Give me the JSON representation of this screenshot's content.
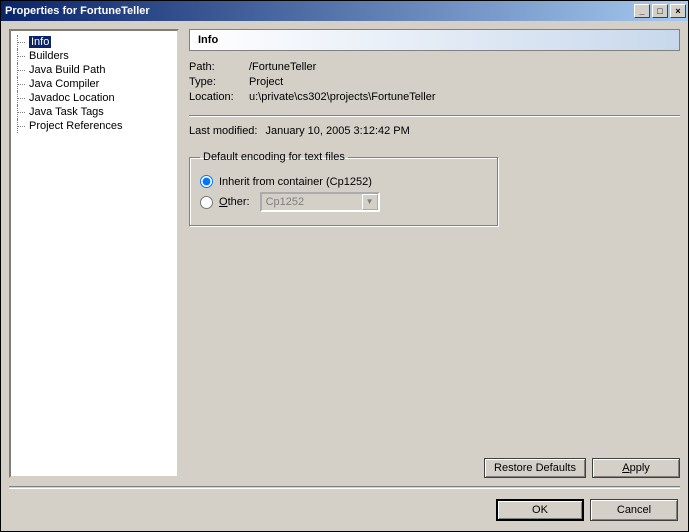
{
  "window": {
    "title": "Properties for FortuneTeller"
  },
  "sidebar": {
    "items": [
      {
        "label": "Info",
        "selected": true
      },
      {
        "label": "Builders"
      },
      {
        "label": "Java Build Path"
      },
      {
        "label": "Java Compiler"
      },
      {
        "label": "Javadoc Location"
      },
      {
        "label": "Java Task Tags"
      },
      {
        "label": "Project References"
      }
    ]
  },
  "panel": {
    "header": "Info",
    "path_label": "Path:",
    "path_value": "/FortuneTeller",
    "type_label": "Type:",
    "type_value": "Project",
    "location_label": "Location:",
    "location_value": "u:\\private\\cs302\\projects\\FortuneTeller",
    "lastmod_label": "Last modified:",
    "lastmod_value": "January 10, 2005 3:12:42 PM",
    "encoding_legend": "Default encoding for text files",
    "inherit_label": "Inherit from container (Cp1252)",
    "other_label": "Other:",
    "other_value": "Cp1252",
    "radio_selected": "inherit"
  },
  "buttons": {
    "restore": "Restore Defaults",
    "apply": "Apply",
    "ok": "OK",
    "cancel": "Cancel"
  }
}
